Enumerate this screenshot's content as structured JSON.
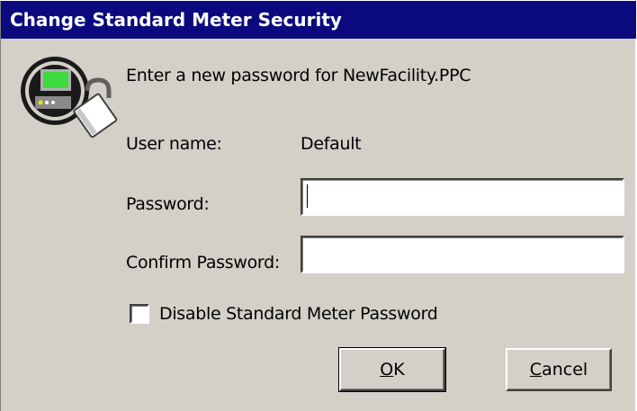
{
  "window": {
    "title": "Change Standard Meter Security"
  },
  "dialog": {
    "prompt": "Enter a new password for NewFacility.PPC",
    "user_name_label": "User name:",
    "user_name_value": "Default",
    "password_label": "Password:",
    "password_value": "",
    "confirm_password_label": "Confirm Password:",
    "confirm_password_value": "",
    "disable_checkbox_label": "Disable Standard Meter Password",
    "disable_checkbox_checked": false
  },
  "buttons": {
    "ok": {
      "mnemonic": "O",
      "rest": "K"
    },
    "cancel": {
      "mnemonic": "C",
      "rest": "ancel"
    }
  },
  "icons": {
    "dialog_icon": "meter-lock-icon"
  },
  "colors": {
    "titlebar": "#0a0a7e",
    "dialog_bg": "#d4d0c8",
    "meter_screen": "#3ddb3d"
  }
}
